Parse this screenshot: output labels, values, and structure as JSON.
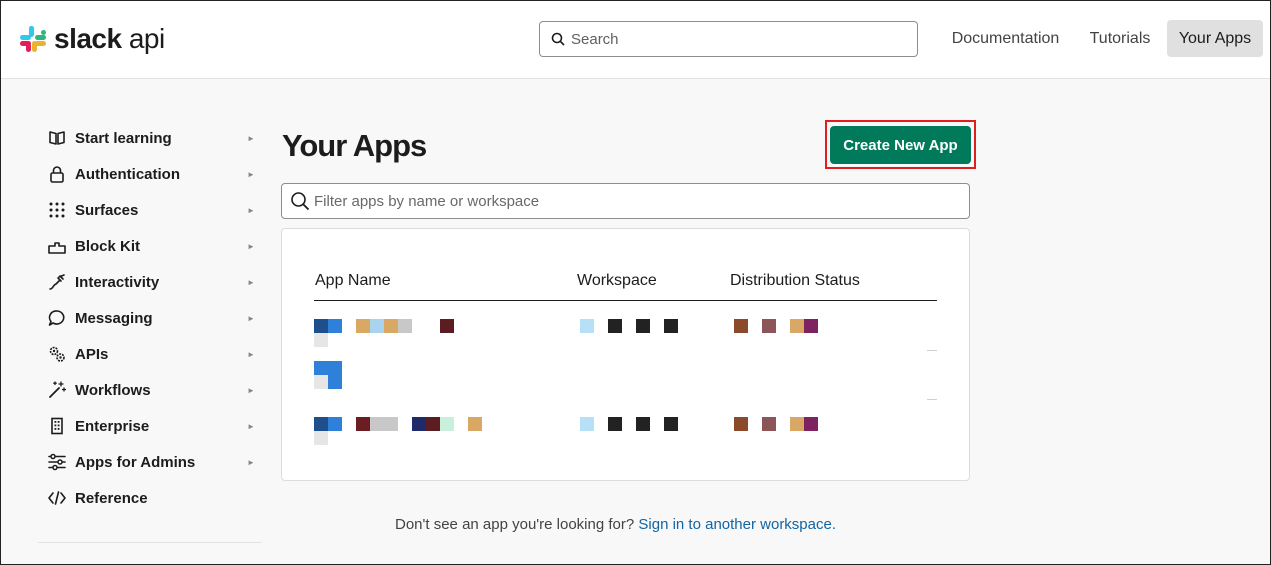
{
  "brand": {
    "logo_bold": "slack",
    "logo_light": "api"
  },
  "search": {
    "placeholder": "Search"
  },
  "nav": {
    "documentation": "Documentation",
    "tutorials": "Tutorials",
    "your_apps": "Your Apps"
  },
  "sidebar": {
    "items": [
      {
        "label": "Start learning",
        "icon": "book-icon"
      },
      {
        "label": "Authentication",
        "icon": "lock-icon"
      },
      {
        "label": "Surfaces",
        "icon": "grid-dots-icon"
      },
      {
        "label": "Block Kit",
        "icon": "blocks-icon"
      },
      {
        "label": "Interactivity",
        "icon": "plug-icon"
      },
      {
        "label": "Messaging",
        "icon": "chat-bubble-icon"
      },
      {
        "label": "APIs",
        "icon": "gears-icon"
      },
      {
        "label": "Workflows",
        "icon": "magic-wand-icon"
      },
      {
        "label": "Enterprise",
        "icon": "building-icon"
      },
      {
        "label": "Apps for Admins",
        "icon": "sliders-icon"
      },
      {
        "label": "Reference",
        "icon": "code-icon"
      }
    ]
  },
  "main": {
    "title": "Your Apps",
    "create_button": "Create New App",
    "filter_placeholder": "Filter apps by name or workspace",
    "table": {
      "columns": [
        "App Name",
        "Workspace",
        "Distribution Status"
      ]
    },
    "footer_text": "Don't see an app you're looking for?",
    "footer_link": "Sign in to another workspace."
  },
  "colors": {
    "accent_green": "#007a5a",
    "highlight_red": "#e01e1e",
    "link_blue": "#1264a3"
  }
}
